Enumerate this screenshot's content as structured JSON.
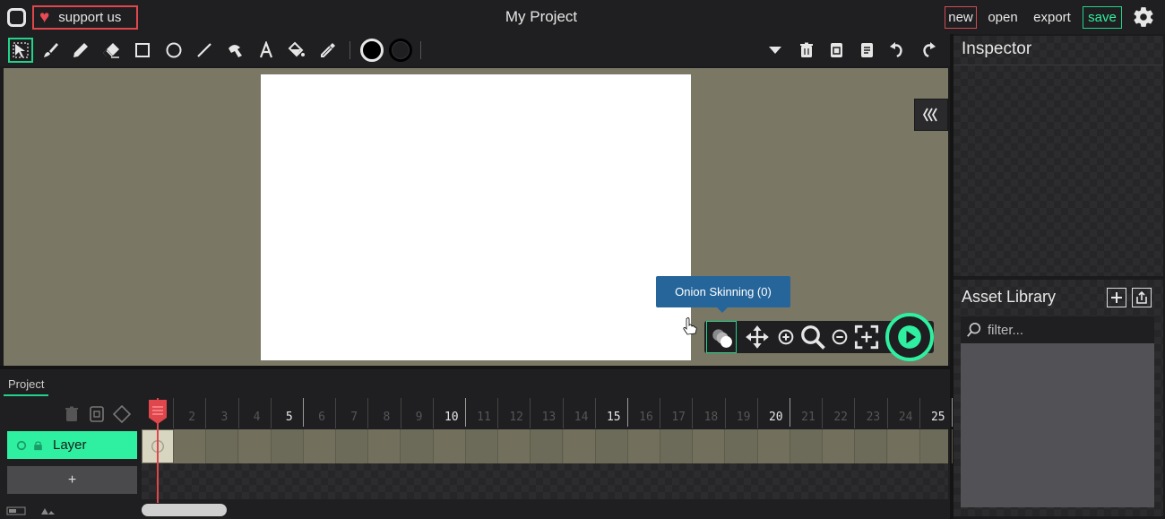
{
  "app": {
    "title": "My Project"
  },
  "topbar": {
    "support_label": "support us",
    "new_label": "new",
    "open_label": "open",
    "export_label": "export",
    "save_label": "save"
  },
  "tooltip": {
    "text": "Onion Skinning (0)"
  },
  "inspector": {
    "title": "Inspector"
  },
  "asset_library": {
    "title": "Asset Library",
    "filter_placeholder": "filter..."
  },
  "timeline": {
    "tab_label": "Project",
    "layer_name": "Layer",
    "add_layer_label": "+",
    "frames": [
      "1",
      "2",
      "3",
      "4",
      "5",
      "6",
      "7",
      "8",
      "9",
      "10",
      "11",
      "12",
      "13",
      "14",
      "15",
      "16",
      "17",
      "18",
      "19",
      "20",
      "21",
      "22",
      "23",
      "24",
      "25"
    ],
    "current_frame": 1
  },
  "colors": {
    "accent": "#2ef0a0",
    "danger": "#e0474c",
    "stage": "#7a7865",
    "tooltip": "#26659a"
  }
}
